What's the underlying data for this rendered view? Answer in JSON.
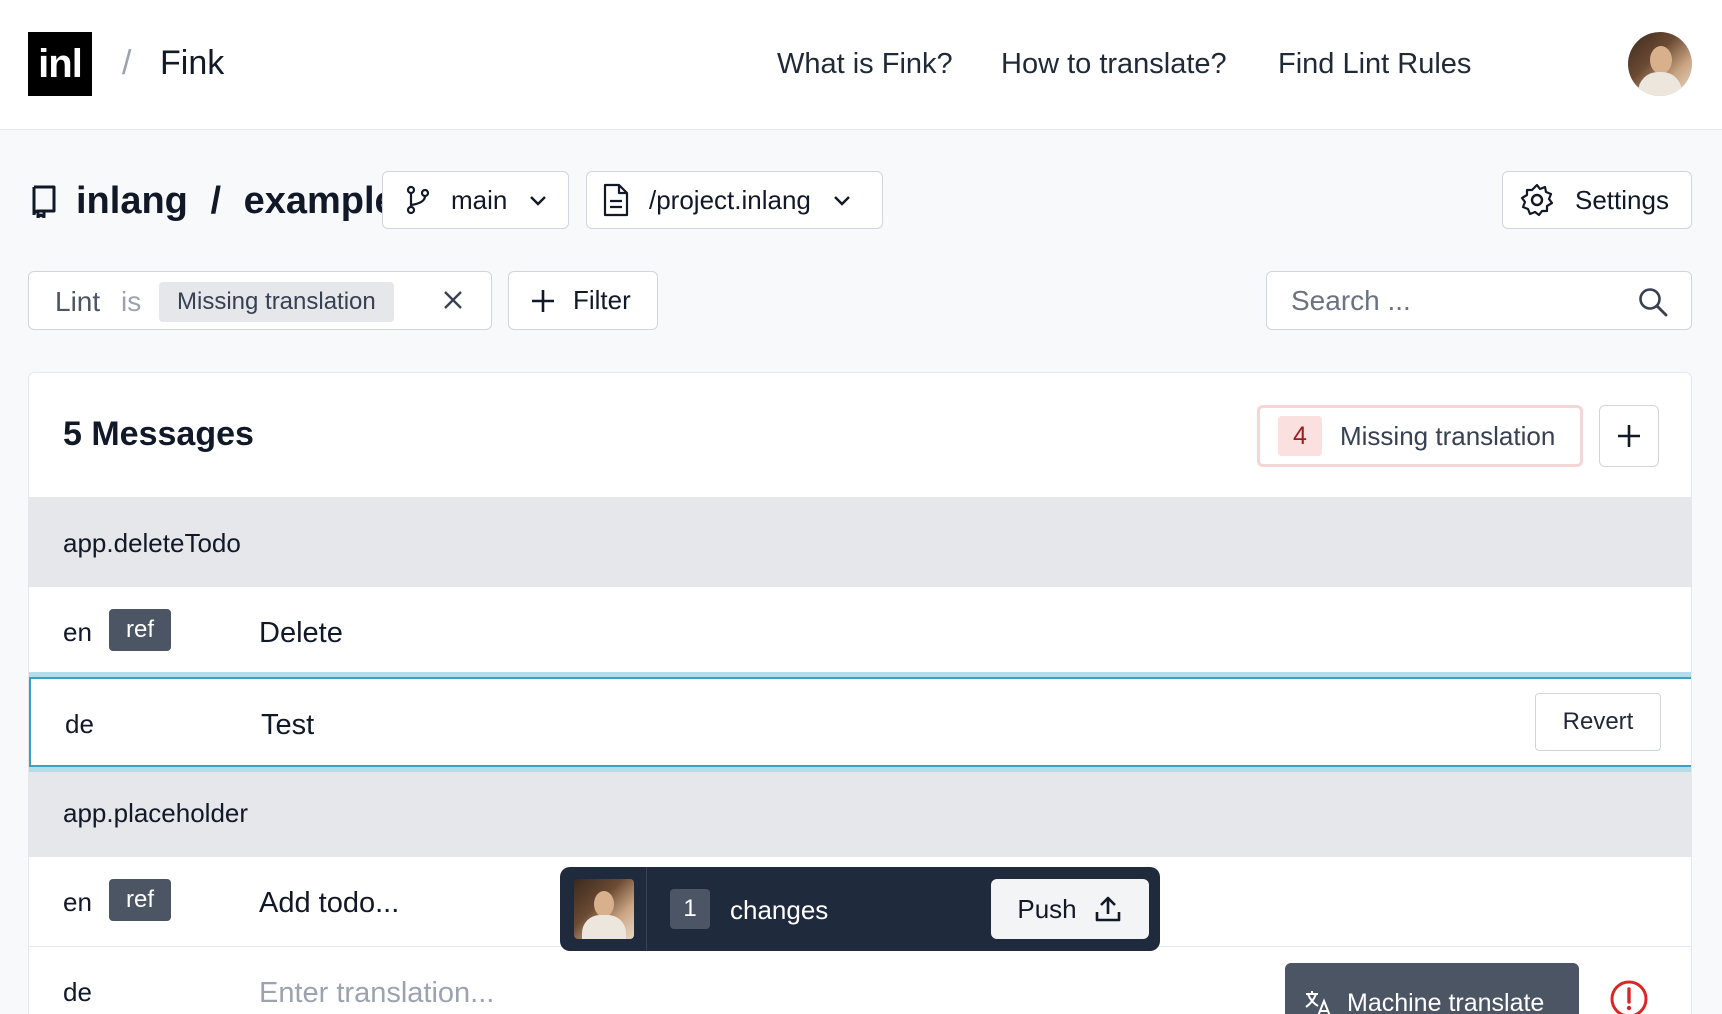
{
  "header": {
    "logo_text": "inl",
    "separator": "/",
    "app_name": "Fink",
    "nav": [
      "What is Fink?",
      "How to translate?",
      "Find Lint Rules"
    ]
  },
  "repo": {
    "owner": "inlang",
    "separator": "/",
    "name": "example",
    "branch": "main",
    "project_file": "/project.inlang",
    "settings_label": "Settings"
  },
  "filters": {
    "active": {
      "key": "Lint",
      "operator": "is",
      "value": "Missing translation"
    },
    "add_filter_label": "Filter",
    "search_placeholder": "Search ..."
  },
  "messages_panel": {
    "title": "5 Messages",
    "lint_count": "4",
    "lint_label": "Missing translation",
    "messages": [
      {
        "key": "app.deleteTodo",
        "patterns": [
          {
            "lang": "en",
            "badge": "ref",
            "text": "Delete"
          },
          {
            "lang": "de",
            "text": "Test",
            "action": "Revert"
          }
        ]
      },
      {
        "key": "app.placeholder",
        "patterns": [
          {
            "lang": "en",
            "badge": "ref",
            "text": "Add todo..."
          },
          {
            "lang": "de",
            "placeholder": "Enter translation...",
            "action": "Machine translate"
          }
        ]
      }
    ]
  },
  "pushbar": {
    "change_count": "1",
    "changes_label": "changes",
    "push_label": "Push"
  },
  "colors": {
    "focus_ring": "#3aa0c4",
    "lint_badge_bg": "#fbe0e0",
    "lint_badge_text": "#9b1c1c",
    "pushbar_bg": "#1f2a3d",
    "warning": "#dc2626"
  }
}
